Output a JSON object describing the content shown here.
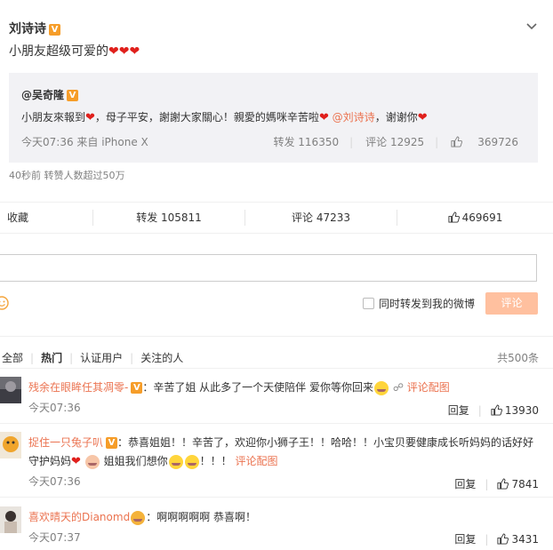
{
  "post": {
    "author": "刘诗诗",
    "text": "小朋友超级可爱的",
    "meta": "40秒前 转赞人数超过50万"
  },
  "repost": {
    "author": "@吴奇隆",
    "text_a": "小朋友來報到",
    "text_b": "，母子平安，謝謝大家關心！親愛的媽咪辛苦啦",
    "mention": "@刘诗诗",
    "text_c": "，谢谢你",
    "meta": "今天07:36 来自 iPhone X",
    "repost_stat": "转发 116350",
    "comment_stat": "评论 12925",
    "like_stat": "369726"
  },
  "actions": {
    "favorite": "收藏",
    "repost": "转发 105811",
    "comment": "评论 47233",
    "like": "469691"
  },
  "compose": {
    "also_repost": "同时转发到我的微博",
    "submit": "评论"
  },
  "filters": {
    "all": "全部",
    "hot": "热门",
    "verified": "认证用户",
    "following": "关注的人",
    "total": "共500条"
  },
  "comments": [
    {
      "name": "残余在眼眸任其凋零-",
      "text": "：辛苦了姐 从此多了一个天使陪伴 爱你等你回来",
      "link": "评论配图",
      "time": "今天07:36",
      "reply": "回复",
      "likes": "13930"
    },
    {
      "name": "捉住一只兔子叭",
      "text_a": "：恭喜姐姐！！辛苦了，欢迎你小狮子王！！哈哈！！小宝贝要健康成长听妈妈的话好好",
      "text_b": "守护妈妈",
      "text_c": "姐姐我们想你",
      "text_d": "！！！",
      "link": "评论配图",
      "time": "今天07:36",
      "reply": "回复",
      "likes": "7841"
    },
    {
      "name": "喜欢晴天的Dianomd",
      "text": "：啊啊啊啊啊 恭喜啊！",
      "time": "今天07:37",
      "reply": "回复",
      "likes": "3431"
    }
  ],
  "colors": {
    "accent": "#eb7350",
    "submit_bg": "#ffc09f",
    "repost_bg": "#f2f2f5",
    "muted": "#808080"
  }
}
